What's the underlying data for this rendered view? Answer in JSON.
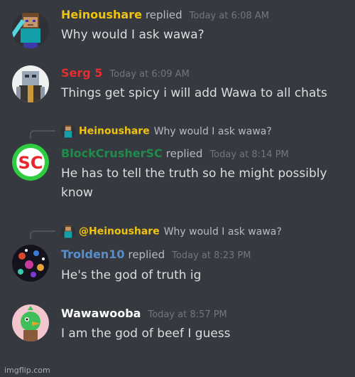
{
  "messages": [
    {
      "author": "Heinoushare",
      "author_color": "#f1c40f",
      "replied": "replied",
      "timestamp": "Today at 6:08 AM",
      "text": "Why would I ask wawa?"
    },
    {
      "author": "Serg 5",
      "author_color": "#e62e2e",
      "timestamp": "Today at 6:09 AM",
      "text": "Things get spicy i will add Wawa to all chats"
    },
    {
      "reply_to": {
        "name": "Heinoushare",
        "text": "Why would I ask wawa?"
      },
      "author": "BlockCrusherSC",
      "author_color": "#1f8b4c",
      "replied": "replied",
      "timestamp": "Today at 8:14 PM",
      "text": "He has to tell the truth so he might possibly know"
    },
    {
      "reply_to": {
        "name": "@Heinoushare",
        "text": "Why would I ask wawa?"
      },
      "author": "Trolden10",
      "author_color": "#5a8ec8",
      "replied": "replied",
      "timestamp": "Today at 8:23 PM",
      "text": "He's the god of truth ig"
    },
    {
      "author": "Wawawooba",
      "author_color": "#ffffff",
      "timestamp": "Today at 8:57 PM",
      "text": "I am the god of beef I guess"
    }
  ],
  "icons": {
    "heinoushare": "minecraft-steve-avatar-icon",
    "serg": "knight-avatar-icon",
    "blockcrusher": "sc-logo-avatar-icon",
    "trolden": "galaxy-avatar-icon",
    "wawawooba": "green-bird-avatar-icon"
  },
  "watermark": "imgflip.com"
}
